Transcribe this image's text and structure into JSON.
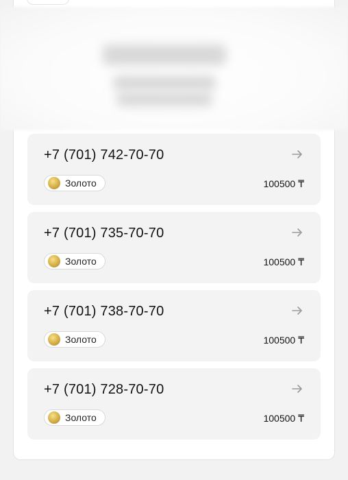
{
  "numbers": [
    {
      "phone": "+7 (701) 742-70-70",
      "tier": "Золото",
      "price": "100500 ₸"
    },
    {
      "phone": "+7 (701) 735-70-70",
      "tier": "Золото",
      "price": "100500 ₸"
    },
    {
      "phone": "+7 (701) 738-70-70",
      "tier": "Золото",
      "price": "100500 ₸"
    },
    {
      "phone": "+7 (701) 728-70-70",
      "tier": "Золото",
      "price": "100500 ₸"
    }
  ],
  "colors": {
    "background": "#f2f2f2",
    "card": "#f3f3f3",
    "gold": "#d8b24a",
    "arrow": "#9a9a9a"
  },
  "icons": {
    "arrow": "arrow-right-icon",
    "coin": "gold-coin-icon"
  }
}
